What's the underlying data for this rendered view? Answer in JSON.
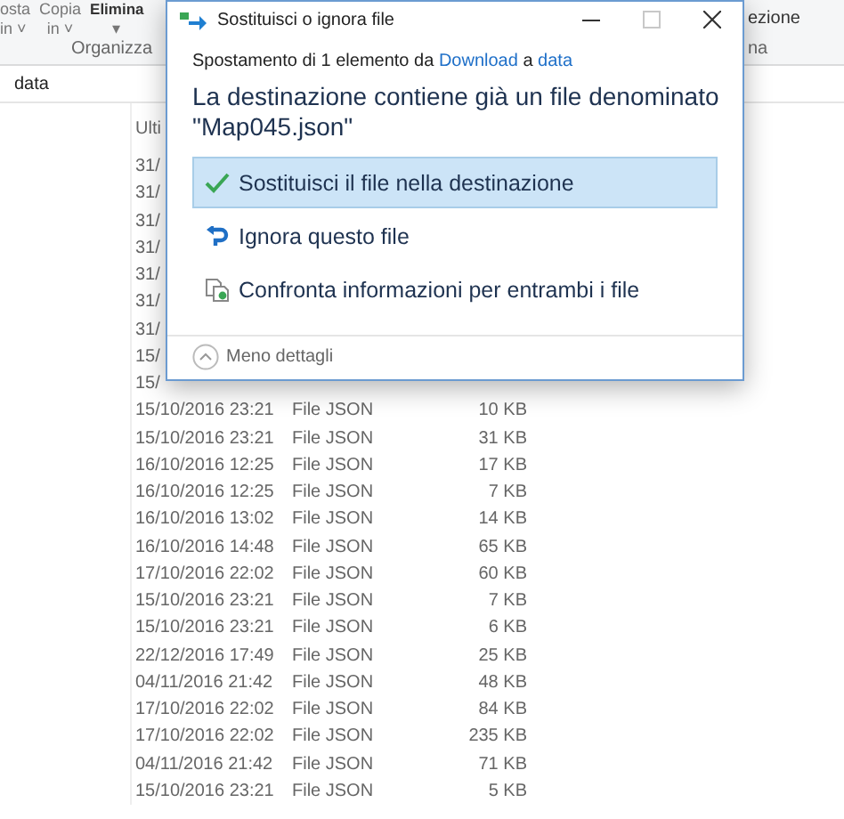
{
  "ribbon": {
    "buttons": [
      {
        "label": "osta",
        "sub": "in ˅"
      },
      {
        "label": "Copia",
        "sub": "in ˅"
      },
      {
        "label": "Elimina",
        "sub": "▾"
      }
    ],
    "group_label": "Organizza",
    "right_label": "ezione",
    "right_group_label": "na"
  },
  "address_bar": {
    "path": "data"
  },
  "file_list": {
    "column_header": "Ulti",
    "rows": [
      {
        "date": "31/"
      },
      {
        "date": "31/"
      },
      {
        "date": "31/"
      },
      {
        "date": "31/"
      },
      {
        "date": "31/"
      },
      {
        "date": "31/"
      },
      {
        "date": "31/"
      },
      {
        "date": "15/"
      },
      {
        "date": "15/"
      },
      {
        "date": "15/10/2016 23:21",
        "type": "File JSON",
        "size": "10 KB"
      },
      {
        "date": "15/10/2016 23:21",
        "type": "File JSON",
        "size": "31 KB"
      },
      {
        "date": "16/10/2016 12:25",
        "type": "File JSON",
        "size": "17 KB"
      },
      {
        "date": "16/10/2016 12:25",
        "type": "File JSON",
        "size": "7 KB"
      },
      {
        "date": "16/10/2016 13:02",
        "type": "File JSON",
        "size": "14 KB"
      },
      {
        "date": "16/10/2016 14:48",
        "type": "File JSON",
        "size": "65 KB"
      },
      {
        "date": "17/10/2016 22:02",
        "type": "File JSON",
        "size": "60 KB"
      },
      {
        "date": "15/10/2016 23:21",
        "type": "File JSON",
        "size": "7 KB"
      },
      {
        "date": "15/10/2016 23:21",
        "type": "File JSON",
        "size": "6 KB"
      },
      {
        "date": "22/12/2016 17:49",
        "type": "File JSON",
        "size": "25 KB"
      },
      {
        "date": "04/11/2016 21:42",
        "type": "File JSON",
        "size": "48 KB"
      },
      {
        "date": "17/10/2016 22:02",
        "type": "File JSON",
        "size": "84 KB"
      },
      {
        "date": "17/10/2016 22:02",
        "type": "File JSON",
        "size": "235 KB"
      },
      {
        "date": "04/11/2016 21:42",
        "type": "File JSON",
        "size": "71 KB"
      },
      {
        "date": "15/10/2016 23:21",
        "type": "File JSON",
        "size": "5 KB"
      }
    ]
  },
  "dialog": {
    "title": "Sostituisci o ignora file",
    "maximize_disabled": true,
    "info": {
      "before": "Spostamento di 1 elemento da ",
      "source": "Download",
      "middle": " a ",
      "destination": "data"
    },
    "heading": "La destinazione contiene già un file denominato \"Map045.json\"",
    "options": [
      {
        "kind": "replace",
        "label": "Sostituisci il file nella destinazione",
        "selected": true
      },
      {
        "kind": "skip",
        "label": "Ignora questo file",
        "selected": false
      },
      {
        "kind": "compare",
        "label": "Confronta informazioni per entrambi i file",
        "selected": false
      }
    ],
    "details_toggle": "Meno dettagli"
  }
}
